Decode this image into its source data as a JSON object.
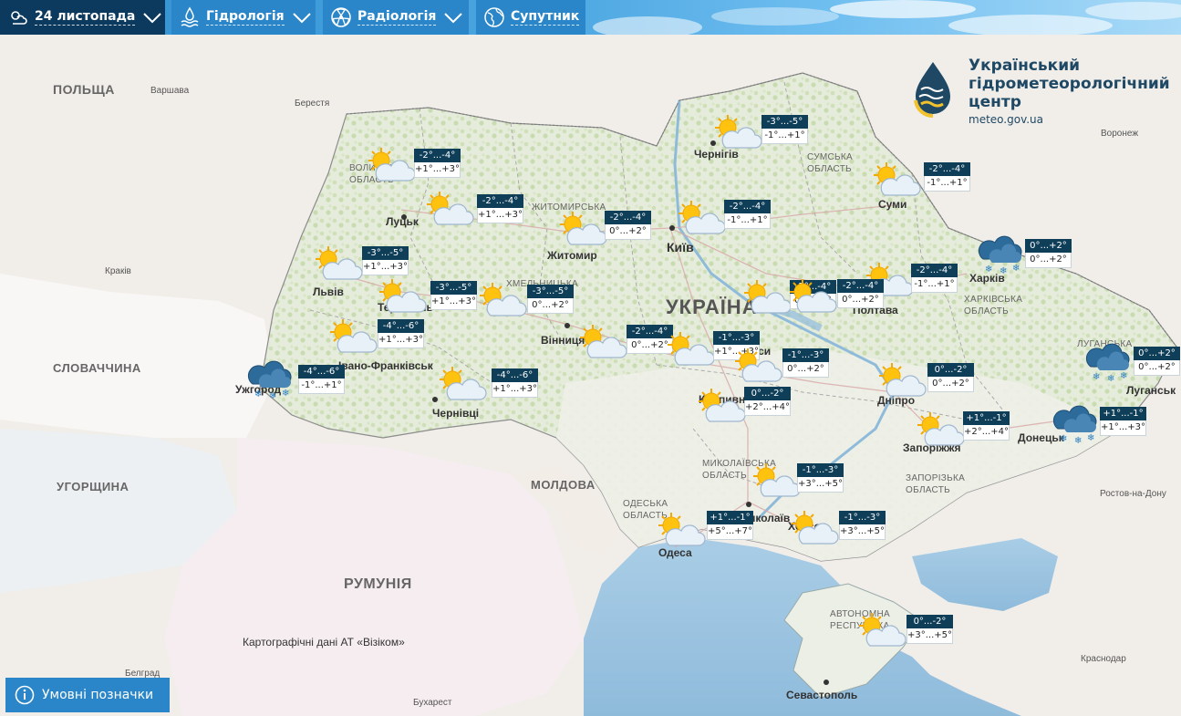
{
  "toolbar": {
    "date_label": "24 листопада",
    "hydro_label": "Гідрологія",
    "radio_label": "Радіологія",
    "satellite_label": "Супутник",
    "accent": "#2a86c8",
    "dark": "#0c3a5e"
  },
  "logo": {
    "name": "Український гідрометеорологічний центр",
    "site": "meteo.gov.ua"
  },
  "credit": "Картографічні дані АТ «Візіком»",
  "legend_button": "Умовні позначки",
  "map": {
    "ukraine_label": "УКРАЇНА",
    "countries": [
      "ПОЛЬЩА",
      "СЛОВАЧЧИНА",
      "УГОРЩИНА",
      "РУМУНІЯ",
      "МОЛДОВА"
    ],
    "foreign_cities": [
      "Варшава",
      "Берестя",
      "Краків",
      "Воронеж",
      "Ростов-на-Дону",
      "Краснодар",
      "Бухарест",
      "Белград"
    ],
    "oblasts": [
      "СУМСЬКА ОБЛАСТЬ",
      "ХАРКІВСЬКА ОБЛАСТЬ",
      "ЛУГАНСЬКА",
      "ЗАПОРІЗЬКА ОБЛАСТЬ",
      "ОДЕСЬКА ОБЛАСТЬ",
      "МИКОЛАЇВСЬКА ОБЛАСТЬ",
      "АВТОНОМНА РЕСПУБЛІКА",
      "ЖИТОМИРСЬКА",
      "ВОЛИНСЬКА ОБЛАСТЬ",
      "ХМЕЛЬНИЦЬКА"
    ],
    "cities": [
      "Луцьк",
      "Львів",
      "Тернопіль",
      "Івано-Франківськ",
      "Ужгород",
      "Чернівці",
      "Житомир",
      "Київ",
      "Вінниця",
      "Чернігів",
      "Суми",
      "Полтава",
      "Харків",
      "Дніпро",
      "Запоріжжя",
      "Донецьк",
      "Луганськ",
      "Миколаїв",
      "Одеса",
      "Херсон",
      "Севастополь",
      "Кропивницький",
      "Черкаси"
    ]
  },
  "forecasts": [
    {
      "night": "-2°...-4°",
      "day": "+1°...+3°",
      "icon": "partly-cloudy-icon"
    },
    {
      "night": "-2°...-4°",
      "day": "+1°...+3°",
      "icon": "partly-cloudy-icon"
    },
    {
      "night": "-3°...-5°",
      "day": "+1°...+3°",
      "icon": "partly-cloudy-icon"
    },
    {
      "night": "-3°...-5°",
      "day": "+1°...+3°",
      "icon": "partly-cloudy-icon"
    },
    {
      "night": "-4°...-6°",
      "day": "+1°...+3°",
      "icon": "partly-cloudy-icon"
    },
    {
      "night": "-4°...-6°",
      "day": "-1°...+1°",
      "icon": "snow-cloud-icon"
    },
    {
      "night": "-4°...-6°",
      "day": "+1°...+3°",
      "icon": "partly-cloudy-icon"
    },
    {
      "night": "-3°...-5°",
      "day": "0°...+2°",
      "icon": "partly-cloudy-icon"
    },
    {
      "night": "-2°...-4°",
      "day": "0°...+2°",
      "icon": "partly-cloudy-icon"
    },
    {
      "night": "-2°...-4°",
      "day": "0°...+2°",
      "icon": "partly-cloudy-icon"
    },
    {
      "night": "-2°...-4°",
      "day": "-1°...+1°",
      "icon": "partly-cloudy-icon"
    },
    {
      "night": "-3°...-5°",
      "day": "-1°...+1°",
      "icon": "partly-cloudy-icon"
    },
    {
      "night": "-2°...-4°",
      "day": "-1°...+1°",
      "icon": "partly-cloudy-icon"
    },
    {
      "night": "-2°...-4°",
      "day": "-1°...+1°",
      "icon": "partly-cloudy-icon"
    },
    {
      "night": "-2°...-4°",
      "day": "0°...+2°",
      "icon": "partly-cloudy-icon"
    },
    {
      "night": "0°...+2°",
      "day": "0°...+2°",
      "icon": "snow-cloud-icon"
    },
    {
      "night": "-1°...-3°",
      "day": "+1°...+3°",
      "icon": "partly-cloudy-icon"
    },
    {
      "night": "-1°...-3°",
      "day": "0°...+2°",
      "icon": "partly-cloudy-icon"
    },
    {
      "night": "0°...-2°",
      "day": "+2°...+4°",
      "icon": "partly-cloudy-icon"
    },
    {
      "night": "0°...-2°",
      "day": "0°...+2°",
      "icon": "partly-cloudy-icon"
    },
    {
      "night": "0°...+2°",
      "day": "0°...+2°",
      "icon": "snow-cloud-icon"
    },
    {
      "night": "+1°...-1°",
      "day": "+1°...+3°",
      "icon": "snow-cloud-icon"
    },
    {
      "night": "+1°...-1°",
      "day": "+2°...+4°",
      "icon": "partly-cloudy-icon"
    },
    {
      "night": "-1°...-3°",
      "day": "+3°...+5°",
      "icon": "partly-cloudy-icon"
    },
    {
      "night": "+1°...-1°",
      "day": "+5°...+7°",
      "icon": "partly-cloudy-icon"
    },
    {
      "night": "-1°...-3°",
      "day": "+3°...+5°",
      "icon": "partly-cloudy-icon"
    },
    {
      "night": "0°...-2°",
      "day": "+3°...+5°",
      "icon": "partly-cloudy-icon"
    },
    {
      "night": "-2°...-4°",
      "day": "0°...+2°",
      "icon": "partly-cloudy-icon"
    }
  ],
  "colors": {
    "sea": "#aacde6",
    "ukraine": "#ecefe6",
    "forest": "#d3e3bf",
    "neighbor": "#f3ecec",
    "night_box": "#0e3e58"
  }
}
